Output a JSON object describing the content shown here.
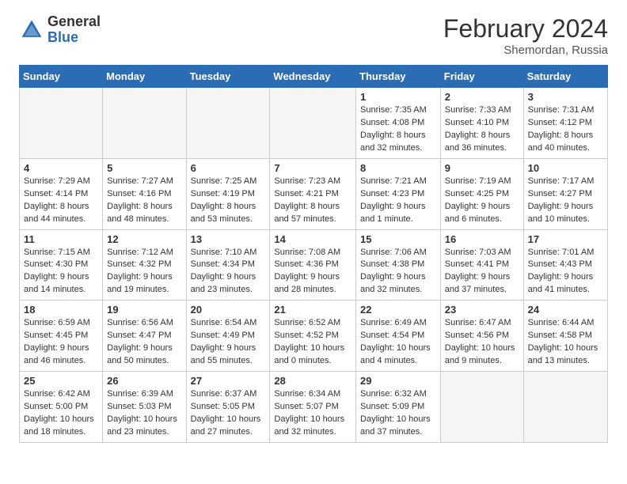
{
  "header": {
    "logo_general": "General",
    "logo_blue": "Blue",
    "month_title": "February 2024",
    "location": "Shemordan, Russia"
  },
  "weekdays": [
    "Sunday",
    "Monday",
    "Tuesday",
    "Wednesday",
    "Thursday",
    "Friday",
    "Saturday"
  ],
  "weeks": [
    [
      {
        "day": "",
        "info": ""
      },
      {
        "day": "",
        "info": ""
      },
      {
        "day": "",
        "info": ""
      },
      {
        "day": "",
        "info": ""
      },
      {
        "day": "1",
        "info": "Sunrise: 7:35 AM\nSunset: 4:08 PM\nDaylight: 8 hours\nand 32 minutes."
      },
      {
        "day": "2",
        "info": "Sunrise: 7:33 AM\nSunset: 4:10 PM\nDaylight: 8 hours\nand 36 minutes."
      },
      {
        "day": "3",
        "info": "Sunrise: 7:31 AM\nSunset: 4:12 PM\nDaylight: 8 hours\nand 40 minutes."
      }
    ],
    [
      {
        "day": "4",
        "info": "Sunrise: 7:29 AM\nSunset: 4:14 PM\nDaylight: 8 hours\nand 44 minutes."
      },
      {
        "day": "5",
        "info": "Sunrise: 7:27 AM\nSunset: 4:16 PM\nDaylight: 8 hours\nand 48 minutes."
      },
      {
        "day": "6",
        "info": "Sunrise: 7:25 AM\nSunset: 4:19 PM\nDaylight: 8 hours\nand 53 minutes."
      },
      {
        "day": "7",
        "info": "Sunrise: 7:23 AM\nSunset: 4:21 PM\nDaylight: 8 hours\nand 57 minutes."
      },
      {
        "day": "8",
        "info": "Sunrise: 7:21 AM\nSunset: 4:23 PM\nDaylight: 9 hours\nand 1 minute."
      },
      {
        "day": "9",
        "info": "Sunrise: 7:19 AM\nSunset: 4:25 PM\nDaylight: 9 hours\nand 6 minutes."
      },
      {
        "day": "10",
        "info": "Sunrise: 7:17 AM\nSunset: 4:27 PM\nDaylight: 9 hours\nand 10 minutes."
      }
    ],
    [
      {
        "day": "11",
        "info": "Sunrise: 7:15 AM\nSunset: 4:30 PM\nDaylight: 9 hours\nand 14 minutes."
      },
      {
        "day": "12",
        "info": "Sunrise: 7:12 AM\nSunset: 4:32 PM\nDaylight: 9 hours\nand 19 minutes."
      },
      {
        "day": "13",
        "info": "Sunrise: 7:10 AM\nSunset: 4:34 PM\nDaylight: 9 hours\nand 23 minutes."
      },
      {
        "day": "14",
        "info": "Sunrise: 7:08 AM\nSunset: 4:36 PM\nDaylight: 9 hours\nand 28 minutes."
      },
      {
        "day": "15",
        "info": "Sunrise: 7:06 AM\nSunset: 4:38 PM\nDaylight: 9 hours\nand 32 minutes."
      },
      {
        "day": "16",
        "info": "Sunrise: 7:03 AM\nSunset: 4:41 PM\nDaylight: 9 hours\nand 37 minutes."
      },
      {
        "day": "17",
        "info": "Sunrise: 7:01 AM\nSunset: 4:43 PM\nDaylight: 9 hours\nand 41 minutes."
      }
    ],
    [
      {
        "day": "18",
        "info": "Sunrise: 6:59 AM\nSunset: 4:45 PM\nDaylight: 9 hours\nand 46 minutes."
      },
      {
        "day": "19",
        "info": "Sunrise: 6:56 AM\nSunset: 4:47 PM\nDaylight: 9 hours\nand 50 minutes."
      },
      {
        "day": "20",
        "info": "Sunrise: 6:54 AM\nSunset: 4:49 PM\nDaylight: 9 hours\nand 55 minutes."
      },
      {
        "day": "21",
        "info": "Sunrise: 6:52 AM\nSunset: 4:52 PM\nDaylight: 10 hours\nand 0 minutes."
      },
      {
        "day": "22",
        "info": "Sunrise: 6:49 AM\nSunset: 4:54 PM\nDaylight: 10 hours\nand 4 minutes."
      },
      {
        "day": "23",
        "info": "Sunrise: 6:47 AM\nSunset: 4:56 PM\nDaylight: 10 hours\nand 9 minutes."
      },
      {
        "day": "24",
        "info": "Sunrise: 6:44 AM\nSunset: 4:58 PM\nDaylight: 10 hours\nand 13 minutes."
      }
    ],
    [
      {
        "day": "25",
        "info": "Sunrise: 6:42 AM\nSunset: 5:00 PM\nDaylight: 10 hours\nand 18 minutes."
      },
      {
        "day": "26",
        "info": "Sunrise: 6:39 AM\nSunset: 5:03 PM\nDaylight: 10 hours\nand 23 minutes."
      },
      {
        "day": "27",
        "info": "Sunrise: 6:37 AM\nSunset: 5:05 PM\nDaylight: 10 hours\nand 27 minutes."
      },
      {
        "day": "28",
        "info": "Sunrise: 6:34 AM\nSunset: 5:07 PM\nDaylight: 10 hours\nand 32 minutes."
      },
      {
        "day": "29",
        "info": "Sunrise: 6:32 AM\nSunset: 5:09 PM\nDaylight: 10 hours\nand 37 minutes."
      },
      {
        "day": "",
        "info": ""
      },
      {
        "day": "",
        "info": ""
      }
    ]
  ]
}
